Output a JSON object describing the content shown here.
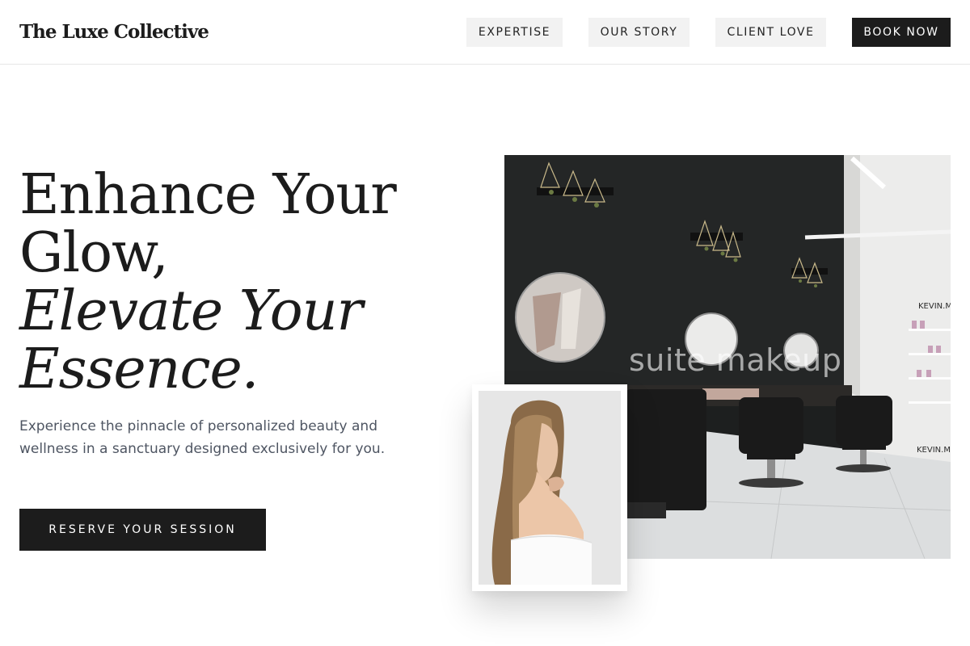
{
  "header": {
    "brand": "The Luxe Collective",
    "nav": [
      {
        "label": "EXPERTISE"
      },
      {
        "label": "OUR STORY"
      },
      {
        "label": "CLIENT LOVE"
      }
    ],
    "book_label": "BOOK NOW"
  },
  "hero": {
    "headline_line1": "Enhance Your",
    "headline_line2": "Glow,",
    "headline_line3": "Elevate Your",
    "headline_line4": "Essence.",
    "lead": "Experience the pinnacle of personalized beauty and wellness in a sanctuary designed exclusively for you.",
    "cta_label": "RESERVE YOUR SESSION"
  },
  "salon_image": {
    "watermark": "suite makeup",
    "sign_top": "KEVIN.M",
    "sign_bottom": "KEVIN.M"
  },
  "colors": {
    "ink": "#1c1c1c",
    "nav_bg": "#f2f2f2",
    "body_text": "#4e5562",
    "background": "#ffffff"
  }
}
